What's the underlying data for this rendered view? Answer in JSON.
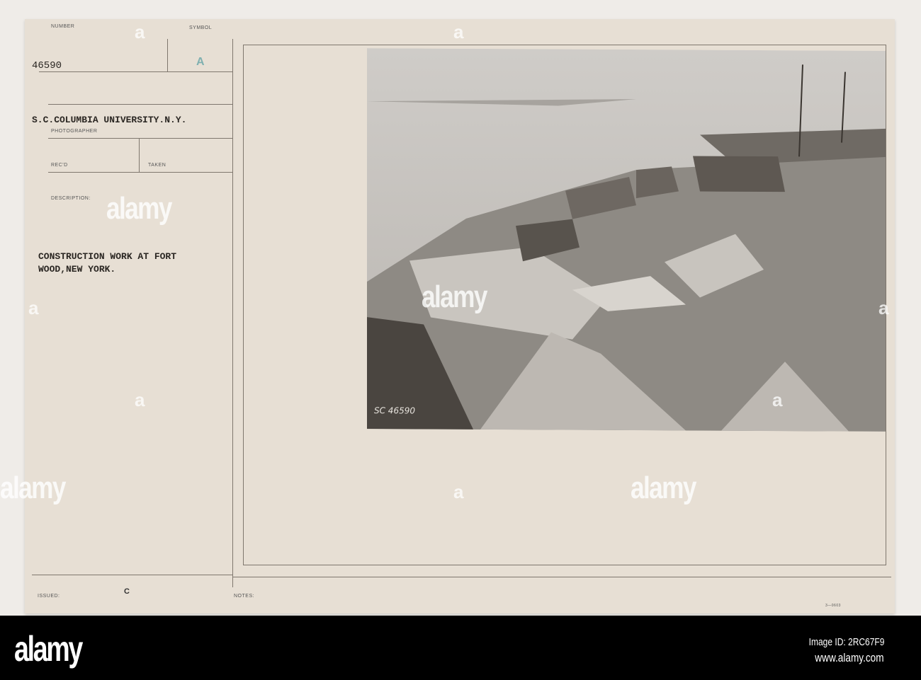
{
  "card": {
    "number_label": "NUMBER",
    "number": "46590",
    "symbol_label": "SYMBOL",
    "symbol": "A",
    "photographer": "S.C.COLUMBIA UNIVERSITY.N.Y.",
    "photographer_label": "PHOTOGRAPHER",
    "recd_label": "REC'D",
    "taken_label": "TAKEN",
    "description_label": "DESCRIPTION:",
    "description_line1": "CONSTRUCTION WORK AT FORT",
    "description_line2": "WOOD,NEW YORK.",
    "issued_label": "ISSUED:",
    "issued_value": "C",
    "notes_label": "NOTES:",
    "form_number": "3—0603",
    "photo_inscription": "SC 46590"
  },
  "watermark": {
    "text": "alamy",
    "letter": "a"
  },
  "footer": {
    "logo": "alamy",
    "image_id": "Image ID: 2RC67F9",
    "url": "www.alamy.com"
  },
  "colors": {
    "card": "#e7dfd4",
    "footer": "#000000",
    "symbol": "#7fb0b0"
  }
}
